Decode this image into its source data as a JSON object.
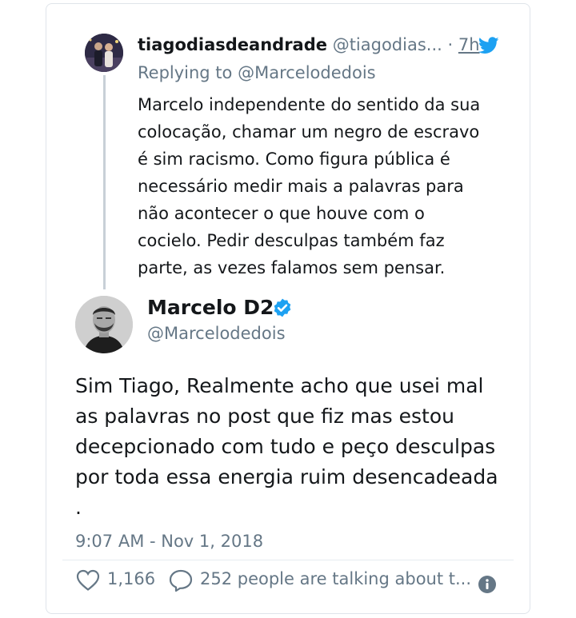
{
  "reply_tweet": {
    "author_name": "tiagodiasdeandrade",
    "author_handle": "@tiagodias...",
    "separator": "·",
    "time": "7h",
    "replying_to_prefix": "Replying to ",
    "replying_to_handle": "@Marcelodedois",
    "text_lines": [
      "Marcelo independente do sentido da sua",
      "colocação, chamar um negro de escravo",
      "é sim racismo. Como figura pública é",
      "necessário medir mais a palavras para",
      "não acontecer o que houve com o",
      "cocielo. Pedir desculpas também faz",
      "parte, as vezes falamos sem pensar."
    ]
  },
  "main_tweet": {
    "author_name": "Marcelo D2",
    "author_handle": "@Marcelodedois",
    "text_lines": [
      "Sim Tiago, Realmente acho que usei mal",
      "as palavras no post que fiz mas estou",
      "decepcionado com tudo e peço desculpas",
      "por toda essa energia ruim desencadeada",
      "."
    ],
    "timestamp": "9:07 AM - Nov 1, 2018",
    "like_count": "1,166",
    "talking_text": "252 people are talking about t..."
  },
  "icons": {
    "brand": "twitter-bird-icon",
    "verified": "verified-badge-icon",
    "like": "heart-icon",
    "comment": "comment-icon",
    "info": "info-icon"
  },
  "colors": {
    "twitter_blue": "#1da1f2",
    "secondary_text": "#657786",
    "primary_text": "#14171a",
    "thread_line": "#c8d0d7"
  }
}
